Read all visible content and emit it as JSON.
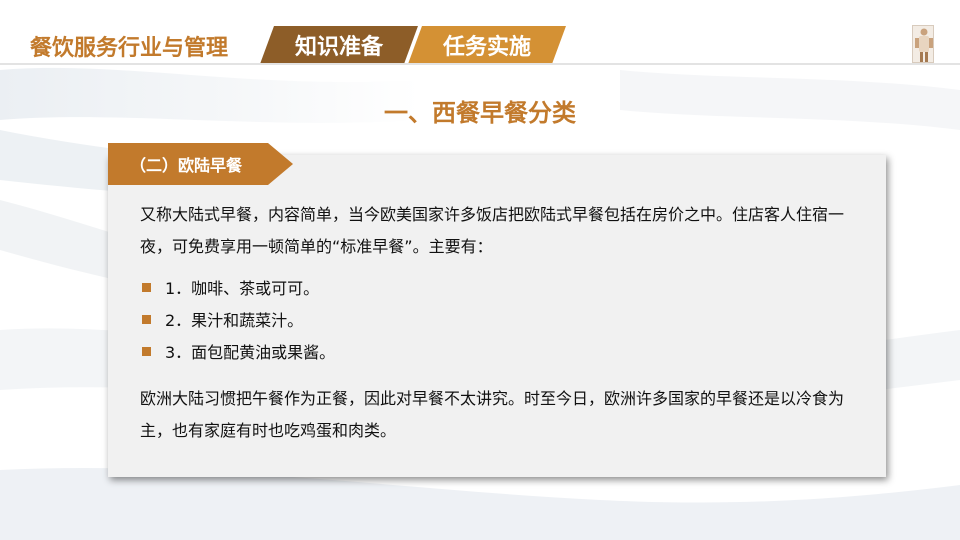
{
  "header": {
    "course_title": "餐饮服务行业与管理",
    "tabs": [
      {
        "label": "知识准备"
      },
      {
        "label": "任务实施"
      }
    ]
  },
  "section_title": "一、西餐早餐分类",
  "panel": {
    "tag": "（二）欧陆早餐",
    "paragraph_1": "又称大陆式早餐，内容简单，当今欧美国家许多饭店把欧陆式早餐包括在房价之中。住店客人住宿一夜，可免费享用一顿简单的“标准早餐”。主要有：",
    "items": [
      "1．咖啡、茶或可可。",
      "2．果汁和蔬菜汁。",
      "3．面包配黄油或果酱。"
    ],
    "paragraph_2": "欧洲大陆习惯把午餐作为正餐，因此对早餐不太讲究。时至今日，欧洲许多国家的早餐还是以冷食为主，也有家庭有时也吃鸡蛋和肉类。"
  },
  "colors": {
    "accent": "#c27a2c",
    "tab_dark": "#8d5d28",
    "tab_light": "#d49134",
    "panel_bg": "#f1f1f1"
  }
}
